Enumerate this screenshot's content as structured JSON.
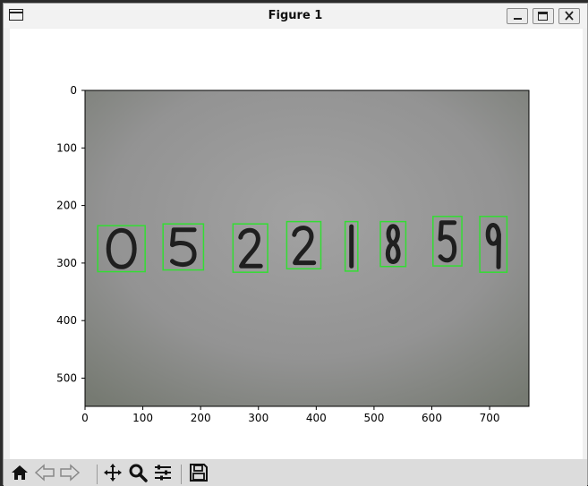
{
  "window": {
    "title": "Figure 1"
  },
  "toolbar": {
    "tools": [
      "home-icon",
      "back-icon",
      "forward-icon",
      "pan-icon",
      "zoom-icon",
      "subplots-icon",
      "save-icon"
    ]
  },
  "chart_data": {
    "type": "image",
    "xticks": [
      "0",
      "100",
      "200",
      "300",
      "400",
      "500",
      "600",
      "700"
    ],
    "yticks": [
      "0",
      "100",
      "200",
      "300",
      "400",
      "500"
    ],
    "xlim": [
      0,
      768
    ],
    "ylim": [
      549,
      0
    ],
    "digits": [
      "0",
      "5",
      "2",
      "2",
      "1",
      "8",
      "5",
      "9"
    ],
    "boxes": [
      {
        "digit": "0",
        "x0": 22,
        "y0": 235,
        "x1": 104,
        "y1": 315
      },
      {
        "digit": "5",
        "x0": 135,
        "y0": 232,
        "x1": 205,
        "y1": 312
      },
      {
        "digit": "2",
        "x0": 256,
        "y0": 232,
        "x1": 316,
        "y1": 316
      },
      {
        "digit": "2",
        "x0": 349,
        "y0": 228,
        "x1": 408,
        "y1": 310
      },
      {
        "digit": "1",
        "x0": 450,
        "y0": 228,
        "x1": 472,
        "y1": 314
      },
      {
        "digit": "8",
        "x0": 511,
        "y0": 228,
        "x1": 555,
        "y1": 306
      },
      {
        "digit": "5",
        "x0": 602,
        "y0": 219,
        "x1": 652,
        "y1": 305
      },
      {
        "digit": "9",
        "x0": 683,
        "y0": 219,
        "x1": 730,
        "y1": 316
      }
    ],
    "box_color": "#33dd33",
    "background_color": "#969696"
  }
}
